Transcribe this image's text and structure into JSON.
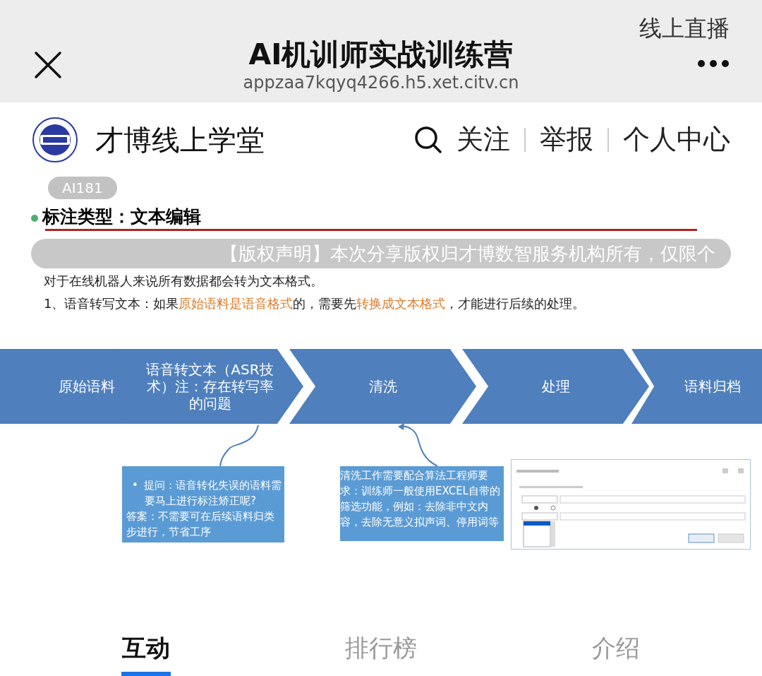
{
  "top_bar": {
    "title": "AI机训师实战训练营",
    "url": "appzaa7kqyq4266.h5.xet.citv.cn",
    "mode_label": "线上直播"
  },
  "nav": {
    "brand": "才博线上学堂",
    "links": [
      "关注",
      "举报",
      "个人中心"
    ]
  },
  "slide": {
    "heading": "标注类型：文本编辑",
    "intro": "对于在线机器人来说所有数据都会转为文本格式。",
    "point": "1、语音转写文本：如果**原始语料是语音格式**的，需要先**转换成文本格式**，才能进行后续的处理。",
    "steps": [
      "原始语料",
      "语音转文本（ASR技术）注：存在转写率的问题",
      "清洗",
      "处理",
      "语料归档"
    ],
    "notes": [
      {
        "bullet": "•",
        "lines": [
          "提问：语音转化失误的语料需要马上进行标注矫正呢?",
          "答案：不需要可在后续语料归类步进行，节省工序"
        ]
      },
      {
        "lines": [
          "清洗工作需要配合算法工程师要求：训练师一般使用EXCEL自带的筛选功能，例如：去除非中文内容，去除无意义拟声词、停用词等"
        ]
      }
    ]
  },
  "overlays": {
    "viewer_badge": "AI181",
    "notice": "【版权声明】本次分享版权归才博数智服务机构所有，仅限个"
  },
  "tabs": [
    {
      "label": "互动",
      "selected": true
    },
    {
      "label": "排行榜",
      "selected": false
    },
    {
      "label": "介绍",
      "selected": false
    }
  ]
}
